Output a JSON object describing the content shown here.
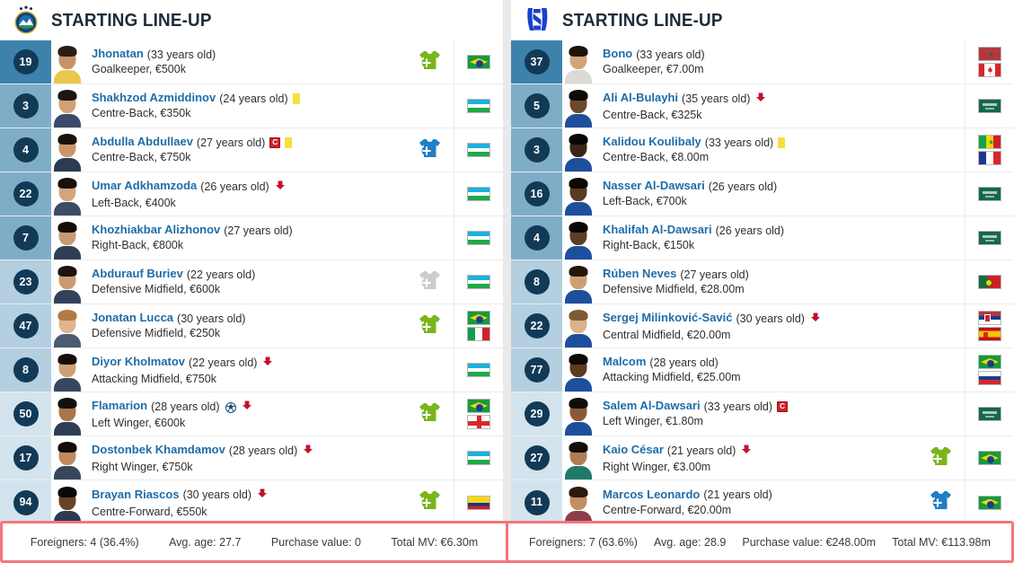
{
  "panels": [
    {
      "crest_name": "pakhtakor-crest",
      "title": "STARTING LINE-UP",
      "players": [
        {
          "number": "19",
          "name": "Jhonatan",
          "age": "(33 years old)",
          "detail": "Goalkeeper, €500k",
          "group": "gk",
          "captain": false,
          "yellow": false,
          "goal": false,
          "off": false,
          "sub": "in-green",
          "flags": [
            "br"
          ],
          "skin": "#c79268",
          "hair": "#2a1d14",
          "shirt": "#e8c84a"
        },
        {
          "number": "3",
          "name": "Shakhzod Azmiddinov",
          "age": "(24 years old)",
          "detail": "Centre-Back, €350k",
          "group": "def",
          "captain": false,
          "yellow": true,
          "goal": false,
          "off": false,
          "sub": "none",
          "flags": [
            "uz"
          ],
          "skin": "#d2a178",
          "hair": "#1d1510",
          "shirt": "#3a4a6a"
        },
        {
          "number": "4",
          "name": "Abdulla Abdullaev",
          "age": "(27 years old)",
          "detail": "Centre-Back, €750k",
          "group": "def",
          "captain": true,
          "yellow": true,
          "goal": false,
          "off": false,
          "sub": "in-blue",
          "flags": [
            "uz"
          ],
          "skin": "#c9966c",
          "hair": "#1a1209",
          "shirt": "#2c3a52"
        },
        {
          "number": "22",
          "name": "Umar Adkhamzoda",
          "age": "(26 years old)",
          "detail": "Left-Back, €400k",
          "group": "def",
          "captain": false,
          "yellow": false,
          "goal": false,
          "off": true,
          "sub": "none",
          "flags": [
            "uz"
          ],
          "skin": "#d4a57d",
          "hair": "#17110b",
          "shirt": "#3b4c63"
        },
        {
          "number": "7",
          "name": "Khozhiakbar Alizhonov",
          "age": "(27 years old)",
          "detail": "Right-Back, €800k",
          "group": "def",
          "captain": false,
          "yellow": false,
          "goal": false,
          "off": false,
          "sub": "none",
          "flags": [
            "uz"
          ],
          "skin": "#c99a71",
          "hair": "#130d08",
          "shirt": "#2f3f56"
        },
        {
          "number": "23",
          "name": "Abdurauf Buriev",
          "age": "(22 years old)",
          "detail": "Defensive Midfield, €600k",
          "group": "mid",
          "captain": false,
          "yellow": false,
          "goal": false,
          "off": false,
          "sub": "out-grey",
          "flags": [
            "uz"
          ],
          "skin": "#cb9a70",
          "hair": "#1b130c",
          "shirt": "#33425a"
        },
        {
          "number": "47",
          "name": "Jonatan Lucca",
          "age": "(30 years old)",
          "detail": "Defensive Midfield, €250k",
          "group": "mid",
          "captain": false,
          "yellow": false,
          "goal": false,
          "off": false,
          "sub": "in-green",
          "flags": [
            "br",
            "it"
          ],
          "skin": "#e0b58d",
          "hair": "#b07a42",
          "shirt": "#4a5b72"
        },
        {
          "number": "8",
          "name": "Diyor Kholmatov",
          "age": "(22 years old)",
          "detail": "Attacking Midfield, €750k",
          "group": "mid",
          "captain": false,
          "yellow": false,
          "goal": false,
          "off": true,
          "sub": "none",
          "flags": [
            "uz"
          ],
          "skin": "#cfa075",
          "hair": "#150f09",
          "shirt": "#37475f"
        },
        {
          "number": "50",
          "name": "Flamarion",
          "age": "(28 years old)",
          "detail": "Left Winger, €600k",
          "group": "fwd",
          "captain": false,
          "yellow": false,
          "goal": true,
          "off": true,
          "sub": "in-green",
          "flags": [
            "br",
            "ge"
          ],
          "skin": "#a9764c",
          "hair": "#14100c",
          "shirt": "#2e3d54"
        },
        {
          "number": "17",
          "name": "Dostonbek Khamdamov",
          "age": "(28 years old)",
          "detail": "Right Winger, €750k",
          "group": "fwd",
          "captain": false,
          "yellow": false,
          "goal": false,
          "off": true,
          "sub": "none",
          "flags": [
            "uz"
          ],
          "skin": "#c2895d",
          "hair": "#120c07",
          "shirt": "#36465d"
        },
        {
          "number": "94",
          "name": "Brayan Riascos",
          "age": "(30 years old)",
          "detail": "Centre-Forward, €550k",
          "group": "fwd",
          "captain": false,
          "yellow": false,
          "goal": false,
          "off": true,
          "sub": "in-green",
          "flags": [
            "co"
          ],
          "skin": "#6a4326",
          "hair": "#0d0805",
          "shirt": "#2b3a50"
        }
      ],
      "summary": {
        "foreigners": "Foreigners: 4 (36.4%)",
        "avg_age": "Avg. age: 27.7",
        "purchase_value": "Purchase value: 0",
        "total_mv": "Total MV: €6.30m"
      }
    },
    {
      "crest_name": "al-hilal-crest",
      "title": "STARTING LINE-UP",
      "players": [
        {
          "number": "37",
          "name": "Bono",
          "age": "(33 years old)",
          "detail": "Goalkeeper, €7.00m",
          "group": "gk",
          "captain": false,
          "yellow": false,
          "goal": false,
          "off": false,
          "sub": "none",
          "flags": [
            "ma",
            "ca"
          ],
          "skin": "#d2a47c",
          "hair": "#1c1309",
          "shirt": "#ddd9d4"
        },
        {
          "number": "5",
          "name": "Ali Al-Bulayhi",
          "age": "(35 years old)",
          "detail": "Centre-Back, €325k",
          "group": "def",
          "captain": false,
          "yellow": false,
          "goal": false,
          "off": true,
          "sub": "none",
          "flags": [
            "sa"
          ],
          "skin": "#6d4a2d",
          "hair": "#100b06",
          "shirt": "#1d4f9c"
        },
        {
          "number": "3",
          "name": "Kalidou Koulibaly",
          "age": "(33 years old)",
          "detail": "Centre-Back, €8.00m",
          "group": "def",
          "captain": false,
          "yellow": true,
          "goal": false,
          "off": false,
          "sub": "none",
          "flags": [
            "sn",
            "fr"
          ],
          "skin": "#3d2416",
          "hair": "#0a0604",
          "shirt": "#1d4f9c"
        },
        {
          "number": "16",
          "name": "Nasser Al-Dawsari",
          "age": "(26 years old)",
          "detail": "Left-Back, €700k",
          "group": "def",
          "captain": false,
          "yellow": false,
          "goal": false,
          "off": false,
          "sub": "none",
          "flags": [
            "sa"
          ],
          "skin": "#5a3a22",
          "hair": "#0c0805",
          "shirt": "#1d4f9c"
        },
        {
          "number": "4",
          "name": "Khalifah Al-Dawsari",
          "age": "(26 years old)",
          "detail": "Right-Back, €150k",
          "group": "def",
          "captain": false,
          "yellow": false,
          "goal": false,
          "off": false,
          "sub": "none",
          "flags": [
            "sa"
          ],
          "skin": "#5e3d25",
          "hair": "#0b0705",
          "shirt": "#1d4f9c"
        },
        {
          "number": "8",
          "name": "Rúben Neves",
          "age": "(27 years old)",
          "detail": "Defensive Midfield, €28.00m",
          "group": "mid",
          "captain": false,
          "yellow": false,
          "goal": false,
          "off": false,
          "sub": "none",
          "flags": [
            "pt"
          ],
          "skin": "#cf9f74",
          "hair": "#241609",
          "shirt": "#1d4f9c"
        },
        {
          "number": "22",
          "name": "Sergej Milinković-Savić",
          "age": "(30 years old)",
          "detail": "Central Midfield, €20.00m",
          "group": "mid",
          "captain": false,
          "yellow": false,
          "goal": false,
          "off": true,
          "sub": "none",
          "flags": [
            "rs",
            "es"
          ],
          "skin": "#dcb28b",
          "hair": "#7d5a33",
          "shirt": "#1d4f9c"
        },
        {
          "number": "77",
          "name": "Malcom",
          "age": "(28 years old)",
          "detail": "Attacking Midfield, €25.00m",
          "group": "mid",
          "captain": false,
          "yellow": false,
          "goal": false,
          "off": false,
          "sub": "none",
          "flags": [
            "br",
            "ru"
          ],
          "skin": "#5d3a22",
          "hair": "#0d0806",
          "shirt": "#1d4f9c"
        },
        {
          "number": "29",
          "name": "Salem Al-Dawsari",
          "age": "(33 years old)",
          "detail": "Left Winger, €1.80m",
          "group": "fwd",
          "captain": true,
          "yellow": false,
          "goal": false,
          "off": false,
          "sub": "none",
          "flags": [
            "sa"
          ],
          "skin": "#8a5a35",
          "hair": "#120c07",
          "shirt": "#1d4f9c"
        },
        {
          "number": "27",
          "name": "Kaio César",
          "age": "(21 years old)",
          "detail": "Right Winger, €3.00m",
          "group": "fwd",
          "captain": false,
          "yellow": false,
          "goal": false,
          "off": true,
          "sub": "in-green",
          "flags": [
            "br"
          ],
          "skin": "#b07d52",
          "hair": "#140d08",
          "shirt": "#1f7a6a"
        },
        {
          "number": "11",
          "name": "Marcos Leonardo",
          "age": "(21 years old)",
          "detail": "Centre-Forward, €20.00m",
          "group": "fwd",
          "captain": false,
          "yellow": false,
          "goal": false,
          "off": false,
          "sub": "in-blue",
          "flags": [
            "br"
          ],
          "skin": "#c08f62",
          "hair": "#2a1a0d",
          "shirt": "#8e3b4a"
        }
      ],
      "summary": {
        "foreigners": "Foreigners: 7 (63.6%)",
        "avg_age": "Avg. age: 28.9",
        "purchase_value": "Purchase value: €248.00m",
        "total_mv": "Total MV: €113.98m"
      }
    }
  ],
  "colors": {
    "group_gk": "#3d82ab",
    "group_def": "#7fadc8",
    "group_mid": "#b3cfe0",
    "group_fwd": "#d3e4ef",
    "badge": "#123a56",
    "name_link": "#1f6ca8",
    "sub_in_green": "#7ab51d",
    "sub_in_blue": "#1f7fc4",
    "sub_out_grey": "#cccccc",
    "yellow_card": "#f5e03c",
    "captain_red": "#cf2029",
    "arrow_red": "#c3102f",
    "footer_border": "#f4767c"
  }
}
